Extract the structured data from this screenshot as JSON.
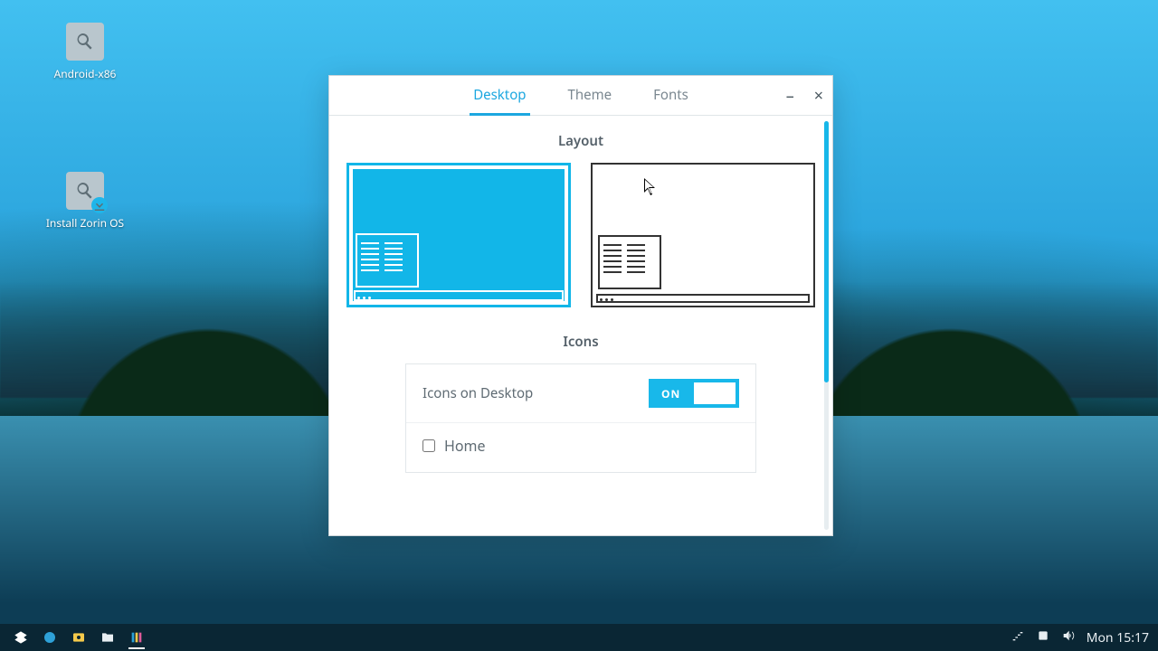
{
  "desktop": {
    "icons": {
      "android": {
        "label": "Android-x86",
        "glyph": "magnify-icon"
      },
      "install": {
        "label": "Install Zorin OS",
        "glyph": "magnify-icon",
        "badge": "download"
      }
    }
  },
  "window": {
    "tabs": {
      "desktop": "Desktop",
      "theme": "Theme",
      "fonts": "Fonts",
      "active": "desktop"
    },
    "controls": {
      "minimize": "–",
      "close": "×"
    },
    "sections": {
      "layout_label": "Layout",
      "icons_label": "Icons"
    },
    "icons_panel": {
      "toggle_label": "Icons on Desktop",
      "toggle_state": "ON",
      "home_label": "Home",
      "home_checked": false
    }
  },
  "taskbar": {
    "items": [
      "zorin-menu",
      "browser",
      "files-photos",
      "files",
      "apps"
    ],
    "right": {
      "network_icon": "network",
      "volume_icon": "volume",
      "clock": "Mon 15:17"
    }
  },
  "colors": {
    "accent": "#12b6e8"
  }
}
